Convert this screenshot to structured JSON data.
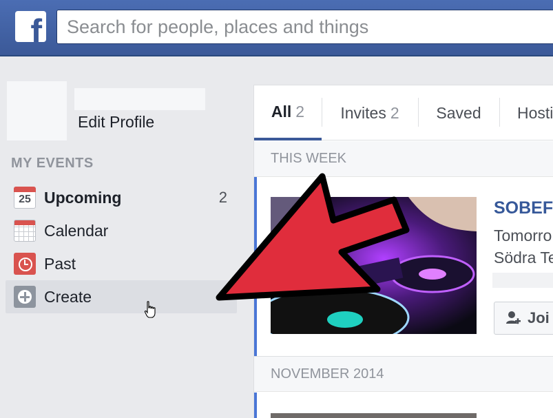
{
  "header": {
    "logo_letter": "f",
    "search_placeholder": "Search for people, places and things"
  },
  "sidebar": {
    "edit_profile": "Edit Profile",
    "section_title": "MY EVENTS",
    "items": [
      {
        "label": "Upcoming",
        "icon": "calendar-date-icon",
        "icon_text": "25",
        "count": "2"
      },
      {
        "label": "Calendar",
        "icon": "calendar-grid-icon"
      },
      {
        "label": "Past",
        "icon": "clock-icon"
      },
      {
        "label": "Create",
        "icon": "plus-circle-icon"
      }
    ]
  },
  "tabs": [
    {
      "label": "All",
      "count": "2"
    },
    {
      "label": "Invites",
      "count": "2"
    },
    {
      "label": "Saved"
    },
    {
      "label": "Hosti"
    }
  ],
  "sections": [
    {
      "title": "THIS WEEK"
    },
    {
      "title": "NOVEMBER 2014"
    }
  ],
  "event": {
    "title": "SOBEF",
    "when": "Tomorro",
    "where": "Södra Te",
    "join_label": "Joi"
  },
  "colors": {
    "brand": "#3b5998",
    "accent_blue": "#4a76d6",
    "arrow_red": "#e02d3c"
  }
}
